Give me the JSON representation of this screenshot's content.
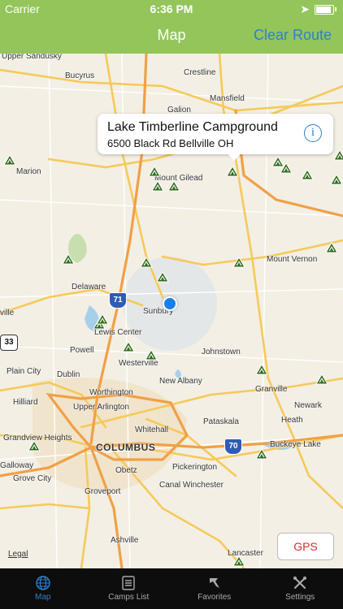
{
  "status_bar": {
    "carrier": "Carrier",
    "time": "6:36 PM"
  },
  "nav": {
    "title": "Map",
    "right_button": "Clear Route"
  },
  "callout": {
    "title": "Lake Timberline Campground",
    "subtitle": "6500 Black Rd Bellville OH"
  },
  "map": {
    "places": [
      {
        "name": "Upper Sandusky"
      },
      {
        "name": "Bucyrus"
      },
      {
        "name": "Crestline"
      },
      {
        "name": "Mansfield"
      },
      {
        "name": "Galion"
      },
      {
        "name": "Marion"
      },
      {
        "name": "Mount Gilead"
      },
      {
        "name": "Mount Vernon"
      },
      {
        "name": "Delaware"
      },
      {
        "name": "Sunbury"
      },
      {
        "name": "Lewis Center"
      },
      {
        "name": "Powell"
      },
      {
        "name": "Westerville"
      },
      {
        "name": "Johnstown"
      },
      {
        "name": "Plain City"
      },
      {
        "name": "Dublin"
      },
      {
        "name": "Worthington"
      },
      {
        "name": "New Albany"
      },
      {
        "name": "Granville"
      },
      {
        "name": "Newark"
      },
      {
        "name": "Hilliard"
      },
      {
        "name": "Upper Arlington"
      },
      {
        "name": "Heath"
      },
      {
        "name": "Whitehall"
      },
      {
        "name": "Pataskala"
      },
      {
        "name": "Grandview Heights"
      },
      {
        "name": "COLUMBUS"
      },
      {
        "name": "Buckeye Lake"
      },
      {
        "name": "Galloway"
      },
      {
        "name": "Grove City"
      },
      {
        "name": "Obetz"
      },
      {
        "name": "Pickerington"
      },
      {
        "name": "Groveport"
      },
      {
        "name": "Canal Winchester"
      },
      {
        "name": "Ashville"
      },
      {
        "name": "Lancaster"
      },
      {
        "name": "ville"
      }
    ],
    "highway_shields": [
      "71",
      "33",
      "70"
    ],
    "legal": "Legal",
    "gps_button": "GPS"
  },
  "tabs": [
    {
      "label": "Map",
      "icon": "globe-icon",
      "active": true
    },
    {
      "label": "Camps List",
      "icon": "list-icon",
      "active": false
    },
    {
      "label": "Favorites",
      "icon": "favorites-icon",
      "active": false
    },
    {
      "label": "Settings",
      "icon": "tools-icon",
      "active": false
    }
  ],
  "colors": {
    "nav_bg": "#93c55b",
    "accent": "#2e7fd0",
    "camp_marker": "#2f6b1c",
    "user_location": "#1a7fe8"
  }
}
